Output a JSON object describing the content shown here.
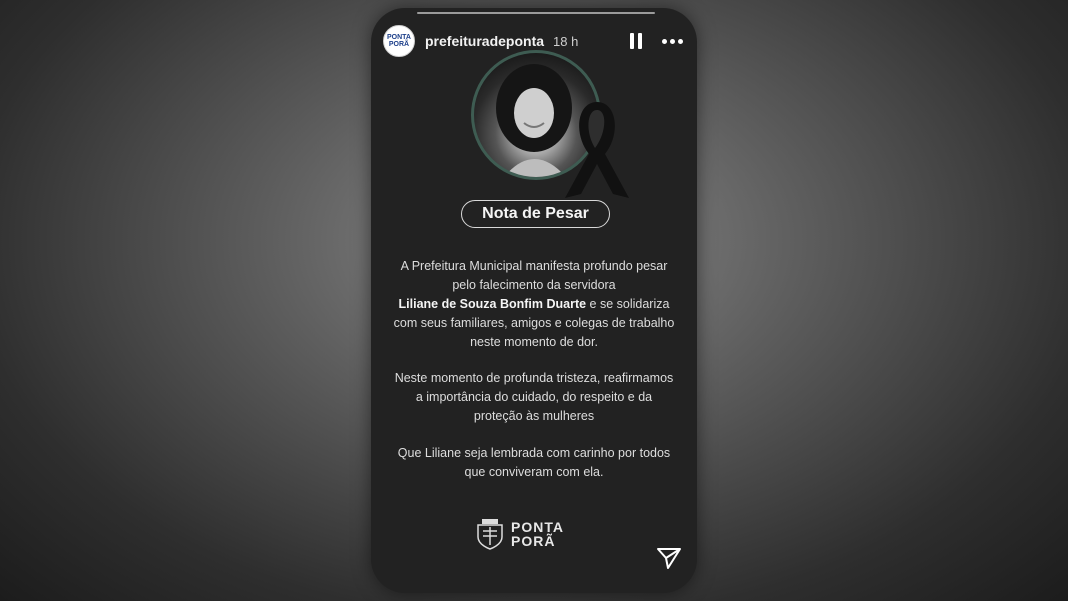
{
  "story": {
    "username": "prefeituradeponta",
    "time": "18 h",
    "avatar_line1": "PONTA",
    "avatar_line2": "PORÃ"
  },
  "post": {
    "title": "Nota de Pesar",
    "p1_before": "A Prefeitura Municipal manifesta profundo pesar pelo falecimento da servidora",
    "p1_name": "Liliane de Souza Bonfim Duarte",
    "p1_after": "e se solidariza com seus familiares, amigos e colegas de trabalho neste momento de dor.",
    "p2": "Neste momento de profunda tristeza, reafirmamos a importância do cuidado, do respeito e da proteção às mulheres",
    "p3": "Que Liliane seja lembrada com carinho por todos que conviveram com ela."
  },
  "logo": {
    "line1": "PONTA",
    "line2": "PORÃ"
  },
  "icons": {
    "pause": "pause-icon",
    "more": "more-options-icon",
    "send": "send-icon",
    "ribbon": "mourning-ribbon-icon"
  },
  "colors": {
    "story_bg": "#222222",
    "photo_ring": "#3e5c52"
  }
}
